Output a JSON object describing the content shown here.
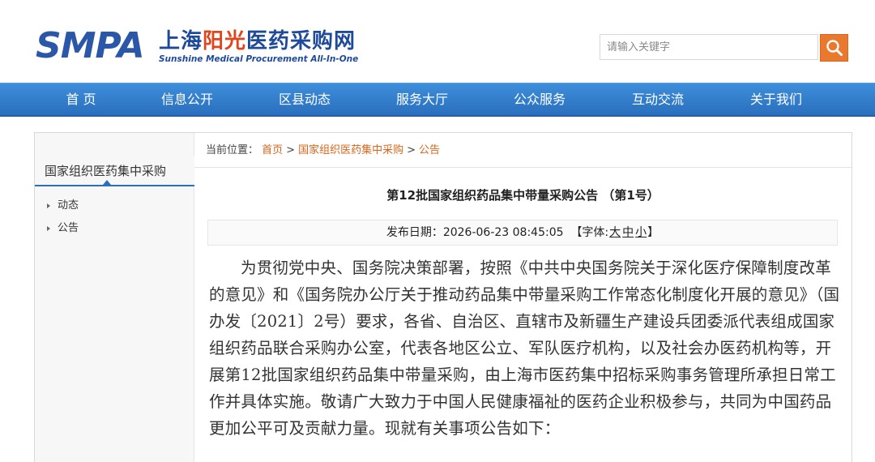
{
  "header": {
    "logo_smpa": "SMPA",
    "logo_cn_prefix": "上海",
    "logo_cn_sun": "阳光",
    "logo_cn_suffix": "医药采购网",
    "logo_en": "Sunshine Medical Procurement All-In-One",
    "search_placeholder": "请输入关键字"
  },
  "nav": {
    "items": [
      "首 页",
      "信息公开",
      "区县动态",
      "服务大厅",
      "公众服务",
      "互动交流",
      "关于我们"
    ]
  },
  "sidebar": {
    "title": "国家组织医药集中采购",
    "items": [
      "动态",
      "公告"
    ]
  },
  "breadcrumb": {
    "prefix": "当前位置：",
    "items": [
      "首页",
      "国家组织医药集中采购",
      "公告"
    ],
    "separator": ">"
  },
  "article": {
    "title": "第12批国家组织药品集中带量采购公告 （第1号）",
    "date_label": "发布日期：",
    "date": "2026-06-23 08:45:05",
    "font_label_open": "【字体:",
    "font_large": "大",
    "font_medium": "中",
    "font_small": "小",
    "font_label_close": "】",
    "body": "为贯彻党中央、国务院决策部署，按照《中共中央国务院关于深化医疗保障制度改革的意见》和《国务院办公厅关于推动药品集中带量采购工作常态化制度化开展的意见》（国办发〔2021〕2号）要求，各省、自治区、直辖市及新疆生产建设兵团委派代表组成国家组织药品联合采购办公室，代表各地区公立、军队医疗机构，以及社会办医药机构等，开展第12批国家组织药品集中带量采购，由上海市医药集中招标采购事务管理所承担日常工作并具体实施。敬请广大致力于中国人民健康福祉的医药企业积极参与，共同为中国药品更加公平可及贡献力量。现就有关事项公告如下："
  },
  "colors": {
    "nav_blue": "#2a6fbd",
    "accent_orange": "#e9792e",
    "link_orange": "#d9661c",
    "logo_blue": "#2b57a8",
    "logo_red": "#e0461e"
  }
}
